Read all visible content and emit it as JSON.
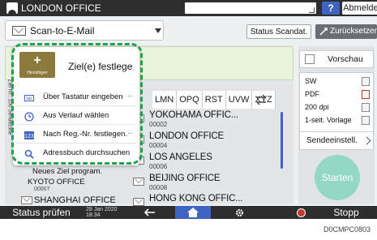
{
  "topbar": {
    "user_name": "LONDON OFFICE",
    "help_label": "?",
    "logout_label": "Abmelden"
  },
  "function_bar": {
    "selected_function": "Scan-to-E-Mail",
    "scan_status_label": "Status Scandat.",
    "reset_label": "Zurücksetzen"
  },
  "popup": {
    "add_button_label": "Hinzufügen",
    "add_destination_label": "Ziel(e) festlege",
    "menu_items": [
      {
        "label": "Über Tastatur eingeben",
        "icon": "keyboard-icon"
      },
      {
        "label": "Aus Verlauf wählen",
        "icon": "history-icon"
      },
      {
        "label": "Nach Reg.-Nr. festlegen.",
        "icon": "number-icon"
      },
      {
        "label": "Adressbuch durchsuchen",
        "icon": "search-icon"
      }
    ],
    "more_label": "..."
  },
  "side_strip_label": "Ziel Nr.: 100 Sendeziele",
  "tabs": [
    "LMN",
    "OPQ",
    "RST",
    "UVW",
    "XYZ"
  ],
  "address_list": [
    {
      "name": "YOKOHAMA OFFIC...",
      "number": "00002"
    },
    {
      "name": "LONDON OFFICE",
      "number": "00004"
    },
    {
      "name": "LOS ANGELES",
      "number": "00006"
    },
    {
      "name": "BEIJING OFFICE",
      "number": "00008"
    },
    {
      "name": "HONG KONG OFFIC...",
      "number": ""
    }
  ],
  "behind_popup": {
    "new_dest": "Neues Ziel program.",
    "kyoto_name": "KYOTO OFFICE",
    "kyoto_number": "00007",
    "shanghai_name": "SHANGHAI OFFICE"
  },
  "right_panel": {
    "preview_label": "Vorschau",
    "settings": [
      "SW",
      "PDF",
      "200 dpi",
      "1-seit. Vorlage"
    ],
    "send_settings_label": "Sendeeinstell.",
    "start_label": "Starten"
  },
  "bottombar": {
    "status_label": "Status prüfen",
    "date": "28 Jan 2020",
    "time": "18:34",
    "stop_label": "Stopp"
  },
  "caption": "D0CMPC0803",
  "colors": {
    "topbar_bg": "#2e2e2e",
    "accent_blue": "#3e63c3",
    "highlight_green": "#1fa24a",
    "start_button": "#93d7c5",
    "add_button": "#8c7a3d"
  }
}
